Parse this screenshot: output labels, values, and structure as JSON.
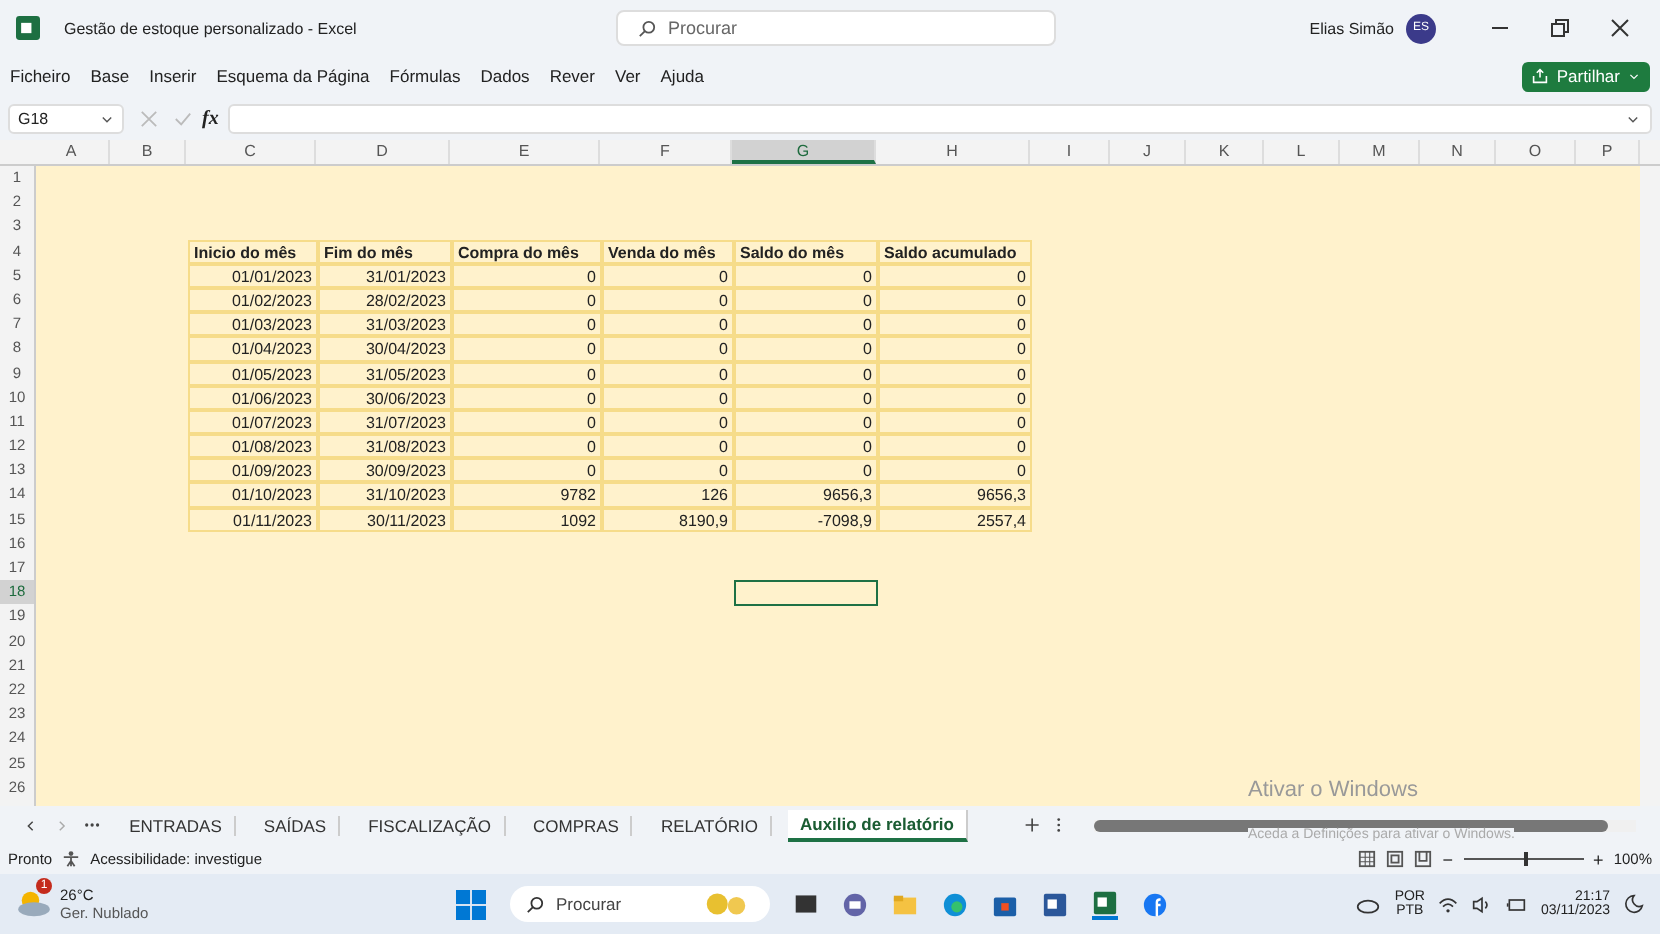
{
  "window": {
    "title": "Gestão de estoque personalizado  -  Excel",
    "search_placeholder": "Procurar",
    "user_name": "Elias Simão",
    "user_initials": "ES"
  },
  "menu": [
    {
      "label": "Ficheiro"
    },
    {
      "label": "Base"
    },
    {
      "label": "Inserir"
    },
    {
      "label": "Esquema da Página"
    },
    {
      "label": "Fórmulas"
    },
    {
      "label": "Dados"
    },
    {
      "label": "Rever"
    },
    {
      "label": "Ver"
    },
    {
      "label": "Ajuda"
    }
  ],
  "share_button": "Partilhar",
  "formula_bar": {
    "name_box": "G18",
    "fx": "fx"
  },
  "sheet": {
    "columns": [
      {
        "label": "A",
        "selected": false
      },
      {
        "label": "B",
        "selected": false
      },
      {
        "label": "C",
        "selected": false
      },
      {
        "label": "D",
        "selected": false
      },
      {
        "label": "E",
        "selected": false
      },
      {
        "label": "F",
        "selected": false
      },
      {
        "label": "G",
        "selected": true
      },
      {
        "label": "H",
        "selected": false
      },
      {
        "label": "I",
        "selected": false
      },
      {
        "label": "J",
        "selected": false
      },
      {
        "label": "K",
        "selected": false
      },
      {
        "label": "L",
        "selected": false
      },
      {
        "label": "M",
        "selected": false
      },
      {
        "label": "N",
        "selected": false
      },
      {
        "label": "O",
        "selected": false
      },
      {
        "label": "P",
        "selected": false
      }
    ],
    "rows": [
      {
        "label": "1",
        "selected": false
      },
      {
        "label": "2",
        "selected": false
      },
      {
        "label": "3",
        "selected": false
      },
      {
        "label": "4",
        "selected": false
      },
      {
        "label": "5",
        "selected": false
      },
      {
        "label": "6",
        "selected": false
      },
      {
        "label": "7",
        "selected": false
      },
      {
        "label": "8",
        "selected": false
      },
      {
        "label": "9",
        "selected": false
      },
      {
        "label": "10",
        "selected": false
      },
      {
        "label": "11",
        "selected": false
      },
      {
        "label": "12",
        "selected": false
      },
      {
        "label": "13",
        "selected": false
      },
      {
        "label": "14",
        "selected": false
      },
      {
        "label": "15",
        "selected": false
      },
      {
        "label": "16",
        "selected": false
      },
      {
        "label": "17",
        "selected": false
      },
      {
        "label": "18",
        "selected": true
      },
      {
        "label": "19",
        "selected": false
      },
      {
        "label": "20",
        "selected": false
      },
      {
        "label": "21",
        "selected": false
      },
      {
        "label": "22",
        "selected": false
      },
      {
        "label": "23",
        "selected": false
      },
      {
        "label": "24",
        "selected": false
      },
      {
        "label": "25",
        "selected": false
      },
      {
        "label": "26",
        "selected": false
      }
    ]
  },
  "table": {
    "columns": [
      "Inicio do mês",
      "Fim do mês",
      "Compra do mês",
      "Venda do mês",
      "Saldo do mês",
      "Saldo acumulado"
    ],
    "rows": [
      [
        "01/01/2023",
        "31/01/2023",
        "0",
        "0",
        "0",
        "0"
      ],
      [
        "01/02/2023",
        "28/02/2023",
        "0",
        "0",
        "0",
        "0"
      ],
      [
        "01/03/2023",
        "31/03/2023",
        "0",
        "0",
        "0",
        "0"
      ],
      [
        "01/04/2023",
        "30/04/2023",
        "0",
        "0",
        "0",
        "0"
      ],
      [
        "01/05/2023",
        "31/05/2023",
        "0",
        "0",
        "0",
        "0"
      ],
      [
        "01/06/2023",
        "30/06/2023",
        "0",
        "0",
        "0",
        "0"
      ],
      [
        "01/07/2023",
        "31/07/2023",
        "0",
        "0",
        "0",
        "0"
      ],
      [
        "01/08/2023",
        "31/08/2023",
        "0",
        "0",
        "0",
        "0"
      ],
      [
        "01/09/2023",
        "30/09/2023",
        "0",
        "0",
        "0",
        "0"
      ],
      [
        "01/10/2023",
        "31/10/2023",
        "9782",
        "126",
        "9656,3",
        "9656,3"
      ],
      [
        "01/11/2023",
        "30/11/2023",
        "1092",
        "8190,9",
        "-7098,9",
        "2557,4"
      ]
    ]
  },
  "sheet_tabs": [
    {
      "label": "ENTRADAS",
      "selected": false
    },
    {
      "label": "SAÍDAS",
      "selected": false
    },
    {
      "label": "FISCALIZAÇÃO",
      "selected": false
    },
    {
      "label": "COMPRAS",
      "selected": false
    },
    {
      "label": "RELATÓRIO",
      "selected": false
    },
    {
      "label": "Auxilio de relatório",
      "selected": true
    }
  ],
  "activation_notice": {
    "title": "Ativar o Windows",
    "text": "Aceda a Definições para ativar o Windows."
  },
  "status_bar": {
    "status": "Pronto",
    "accessibility": "Acessibilidade: investigue",
    "zoom": "100%",
    "zoom_out": "−",
    "zoom_in": "+",
    "zoom_slider": {
      "level": 0.5
    }
  },
  "taskbar": {
    "weather_badge": "1",
    "temperature": "26°C",
    "weather": "Ger. Nublado",
    "search_placeholder": "Procurar",
    "language": "POR",
    "layout": "PTB",
    "time": "21:17",
    "date": "03/11/2023"
  }
}
